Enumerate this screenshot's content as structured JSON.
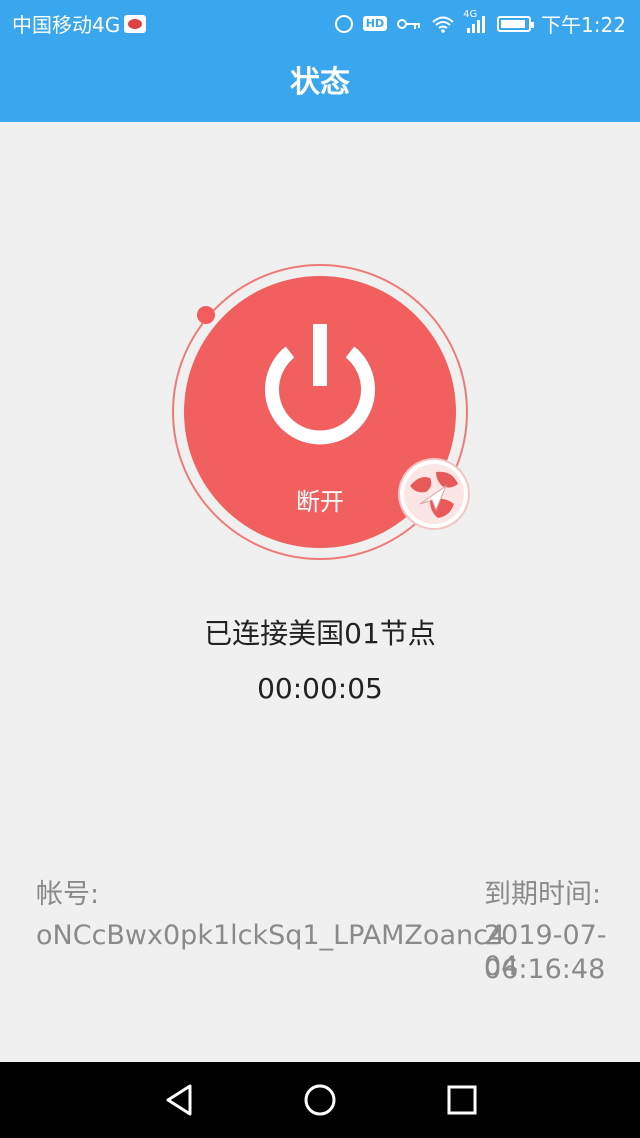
{
  "status_bar": {
    "carrier": "中国移动4G",
    "time": "下午1:22",
    "hd_label": "HD",
    "network_label": "4G",
    "icons": [
      "sina-icon",
      "alarm-icon",
      "hd-icon",
      "key-icon",
      "wifi-icon",
      "signal-icon",
      "battery-icon"
    ]
  },
  "header": {
    "title": "状态"
  },
  "power": {
    "label": "断开",
    "state": "connected",
    "accent_color": "#f25f5f"
  },
  "connection": {
    "status_text": "已连接美国01节点",
    "timer": "00:00:05"
  },
  "account": {
    "label": "帐号:",
    "value": "oNCcBwx0pk1lckSq1_LPAMZoanc4"
  },
  "expiry": {
    "label": "到期时间:",
    "date": "2019-07-04",
    "time": "06:16:48"
  },
  "nav": {
    "icons": [
      "back-icon",
      "home-icon",
      "recent-apps-icon"
    ]
  },
  "colors": {
    "header_bg": "#3aa6ee",
    "background": "#f0f0f0",
    "power_red": "#f25f5f"
  }
}
